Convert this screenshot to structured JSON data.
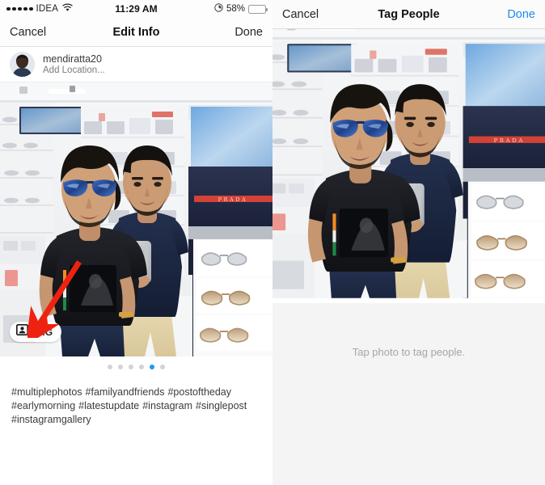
{
  "status_bar": {
    "carrier": "IDEA",
    "signal_dots": 5,
    "wifi_icon": "wifi-icon",
    "time": "11:29 AM",
    "low_power_icon": "low-power-icon",
    "battery_percent": "58%",
    "battery_level": 58
  },
  "left_screen": {
    "nav": {
      "cancel_label": "Cancel",
      "title": "Edit Info",
      "done_label": "Done"
    },
    "user": {
      "avatar_icon": "user-avatar",
      "username": "mendiratta20",
      "location_placeholder": "Add Location..."
    },
    "photo": {
      "alt": "Two young men taking a mirror selfie in an eyewear store",
      "tag_button": {
        "icon": "tag-person-icon",
        "label": "TAG"
      },
      "annotation_arrow": "red-arrow-annotation"
    },
    "carousel": {
      "total_dots": 6,
      "active_index": 4
    },
    "caption": "#multiplephotos  #familyandfriends #postoftheday #earlymorning #latestupdate #instagram #singlepost #instagramgallery"
  },
  "right_screen": {
    "nav": {
      "cancel_label": "Cancel",
      "title": "Tag People",
      "done_label": "Done"
    },
    "photo": {
      "alt": "Two young men taking a mirror selfie in an eyewear store"
    },
    "hint": "Tap photo to tag people."
  },
  "colors": {
    "accent_blue": "#1d8bf1",
    "dot_active": "#2196f3",
    "battery_yellow": "#f7c928",
    "annotation_red": "#ee2211",
    "panel_bg": "#f4f4f4"
  }
}
